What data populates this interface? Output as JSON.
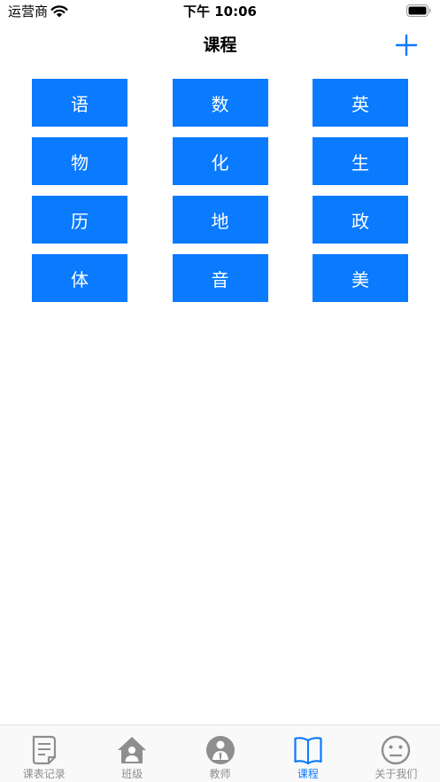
{
  "status_bar": {
    "carrier": "运营商",
    "time": "下午 10:06"
  },
  "nav": {
    "title": "课程",
    "add_icon": "plus-icon"
  },
  "courses": [
    "语",
    "数",
    "英",
    "物",
    "化",
    "生",
    "历",
    "地",
    "政",
    "体",
    "音",
    "美"
  ],
  "tabs": [
    {
      "label": "课表记录",
      "icon": "document-icon",
      "active": false
    },
    {
      "label": "班级",
      "icon": "house-person-icon",
      "active": false
    },
    {
      "label": "教师",
      "icon": "teacher-icon",
      "active": false
    },
    {
      "label": "课程",
      "icon": "book-icon",
      "active": true
    },
    {
      "label": "关于我们",
      "icon": "neutral-face-icon",
      "active": false
    }
  ],
  "colors": {
    "accent": "#0a7aff",
    "tab_inactive": "#8e8e8e"
  }
}
